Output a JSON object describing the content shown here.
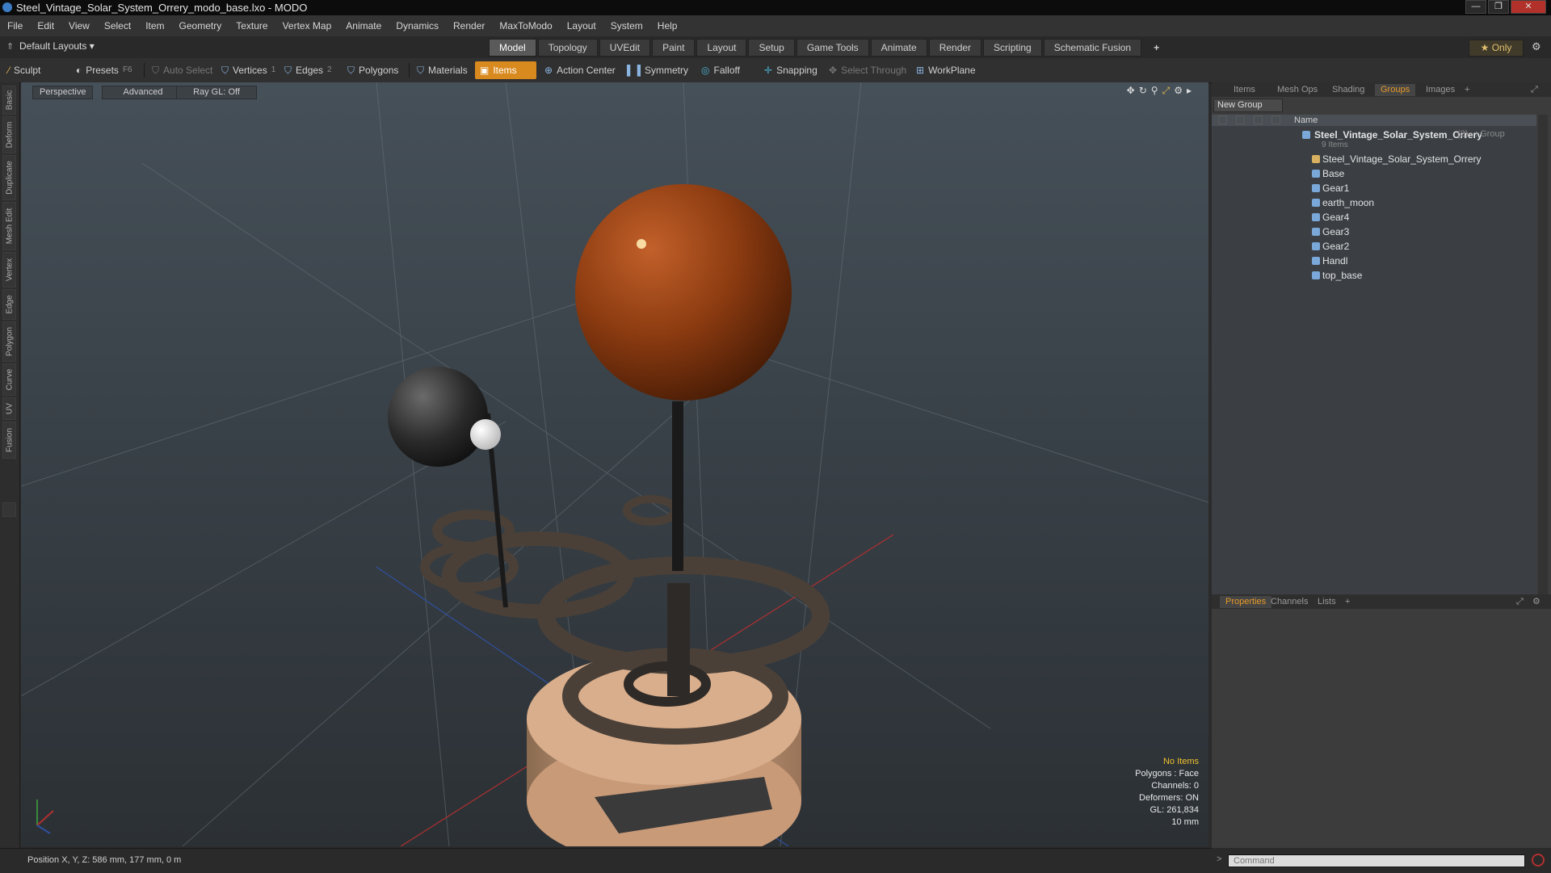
{
  "window": {
    "title": "Steel_Vintage_Solar_System_Orrery_modo_base.lxo - MODO"
  },
  "menu": [
    "File",
    "Edit",
    "View",
    "Select",
    "Item",
    "Geometry",
    "Texture",
    "Vertex Map",
    "Animate",
    "Dynamics",
    "Render",
    "MaxToModo",
    "Layout",
    "System",
    "Help"
  ],
  "layoutbar": {
    "layout_select": "Default Layouts ▾",
    "tabs": [
      "Model",
      "Topology",
      "UVEdit",
      "Paint",
      "Layout",
      "Setup",
      "Game Tools",
      "Animate",
      "Render",
      "Scripting",
      "Schematic Fusion",
      "+"
    ],
    "active_tab": "Model",
    "only_label": "★ Only"
  },
  "toolbar": {
    "sculpt": "Sculpt",
    "presets": "Presets",
    "presets_key": "F6",
    "auto_select": "Auto Select",
    "vertices": "Vertices",
    "vertices_count": "1",
    "edges": "Edges",
    "edges_count": "2",
    "polygons": "Polygons",
    "materials": "Materials",
    "items": "Items",
    "action_center": "Action Center",
    "symmetry": "Symmetry",
    "falloff": "Falloff",
    "snapping": "Snapping",
    "select_through": "Select Through",
    "workplane": "WorkPlane"
  },
  "left_tabs": [
    "Basic",
    "Deform",
    "Duplicate",
    "Mesh Edit",
    "Vertex",
    "Edge",
    "Polygon",
    "Curve",
    "UV",
    "Fusion"
  ],
  "viewport": {
    "view_mode": "Perspective",
    "advanced": "Advanced",
    "raygl": "Ray GL: Off",
    "stats": {
      "selection": "No Items",
      "polygons": "Polygons : Face",
      "channels": "Channels: 0",
      "deformers": "Deformers: ON",
      "gl": "GL: 261,834",
      "scale": "10 mm"
    }
  },
  "right_panel": {
    "tabs": [
      "Items",
      "Mesh Ops",
      "Shading",
      "Groups",
      "Images",
      "+"
    ],
    "active_tab": "Groups",
    "new_group": "New Group",
    "column_name": "Name",
    "group": {
      "name": "Steel_Vintage_Solar_System_Orrery",
      "count": "(2)",
      "type": ": Group",
      "items_label": "9 Items"
    },
    "children": [
      "Steel_Vintage_Solar_System_Orrery",
      "Base",
      "Gear1",
      "earth_moon",
      "Gear4",
      "Gear3",
      "Gear2",
      "Handl",
      "top_base"
    ],
    "bottom_tabs": [
      "Properties",
      "Channels",
      "Lists",
      "+"
    ],
    "bottom_active": "Properties"
  },
  "status": {
    "position": "Position X, Y, Z:   586 mm, 177 mm, 0 m"
  },
  "command": {
    "placeholder": "Command"
  },
  "colors": {
    "accent": "#e79a28",
    "items_active": "#d98a1e",
    "sun": "#8a3a10"
  }
}
